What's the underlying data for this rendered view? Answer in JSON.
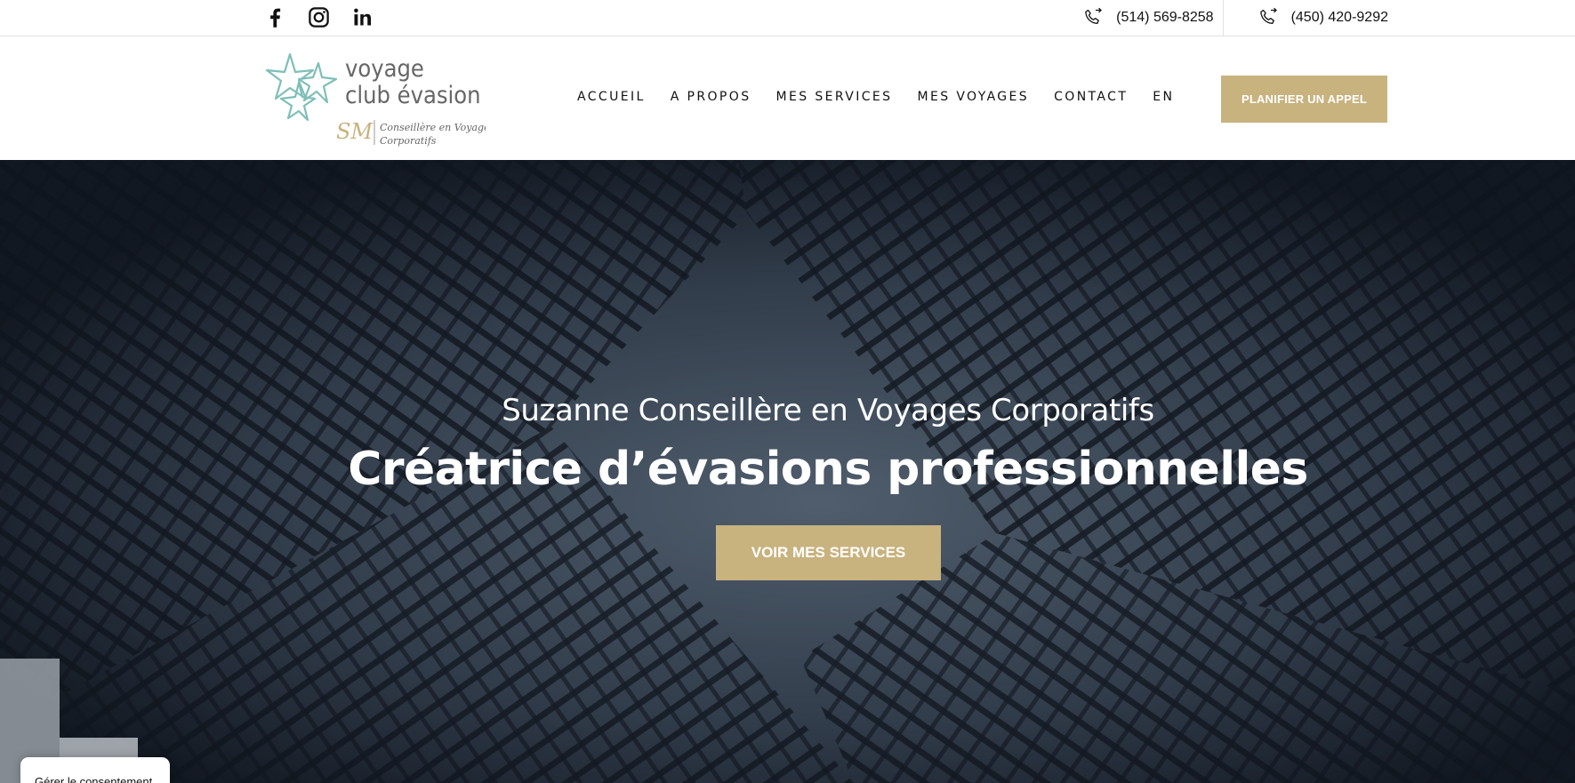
{
  "topbar": {
    "social": [
      {
        "icon": "facebook-icon"
      },
      {
        "icon": "instagram-icon"
      },
      {
        "icon": "linkedin-icon"
      }
    ],
    "phones": [
      {
        "icon": "phone-icon",
        "number": "(514) 569-8258"
      },
      {
        "icon": "phone-icon",
        "number": "(450) 420-9292"
      }
    ]
  },
  "header": {
    "logo": {
      "line1": "voyage",
      "line2": "club évasion",
      "monogram": "SM",
      "tagline1": "Conseillère en Voyages",
      "tagline2": "Corporatifs"
    },
    "nav": [
      "ACCUEIL",
      "A PROPOS",
      "MES SERVICES",
      "MES VOYAGES",
      "CONTACT",
      "EN"
    ],
    "cta": "PLANIFIER UN APPEL"
  },
  "hero": {
    "subtitle": "Suzanne Conseillère en Voyages Corporatifs",
    "title": "Créatrice d’évasions professionnelles",
    "button": "VOIR MES SERVICES"
  },
  "consent": {
    "label": "Gérer le consentement"
  },
  "colors": {
    "accent": "#c8b27e",
    "logo_teal": "#7fbfb8",
    "logo_grey": "#666666"
  }
}
